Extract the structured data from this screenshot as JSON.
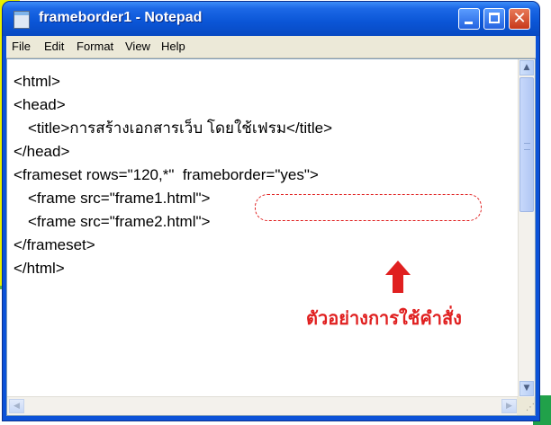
{
  "window": {
    "title": "frameborder1 - Notepad",
    "titlebar_color": "#0a55d6",
    "buttons": [
      "minimize-icon",
      "maximize-icon",
      "close-icon"
    ],
    "close_glyph": "✕"
  },
  "menu": [
    "File",
    "Edit",
    "Format",
    "View",
    "Help"
  ],
  "editor": {
    "lines": [
      "<html>",
      "<head>",
      "<title>การสร้างเอกสารเว็บ โดยใช้เฟรม</title>",
      "</head>",
      "<frameset rows=\"120,*\"  frameborder=\"yes\">",
      "<frame src=\"frame1.html\">",
      "<frame src=\"frame2.html\">",
      "</frameset>",
      "</html>"
    ]
  },
  "annotation": {
    "caption": "ตัวอย่างการใช้คำสั่ง",
    "color": "#e02020",
    "arrow_icon": "up-arrow-icon"
  }
}
